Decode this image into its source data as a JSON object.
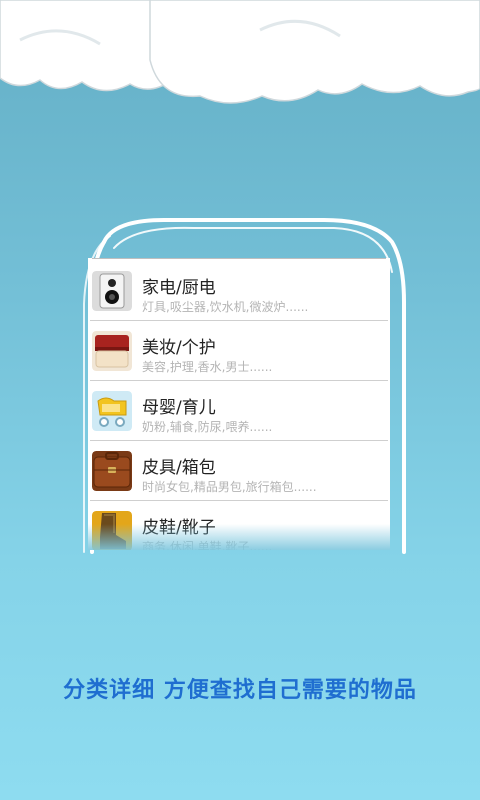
{
  "categories": [
    {
      "title": "家电/厨电",
      "subtitle": "灯具,吸尘器,饮水机,微波炉......",
      "icon": "speaker-icon"
    },
    {
      "title": "美妆/个护",
      "subtitle": "美容,护理,香水,男士......",
      "icon": "cosmetics-jar-icon"
    },
    {
      "title": "母婴/育儿",
      "subtitle": "奶粉,辅食,防尿,喂养......",
      "icon": "baby-stroller-icon"
    },
    {
      "title": "皮具/箱包",
      "subtitle": "时尚女包,精品男包,旅行箱包......",
      "icon": "briefcase-icon"
    },
    {
      "title": "皮鞋/靴子",
      "subtitle": "商务,休闲,单鞋,靴子......",
      "icon": "boot-icon"
    }
  ],
  "tagline": "分类详细 方便查找自己需要的物品",
  "colors": {
    "tagline": "#1f6ed0",
    "background": "#73bfd6"
  }
}
